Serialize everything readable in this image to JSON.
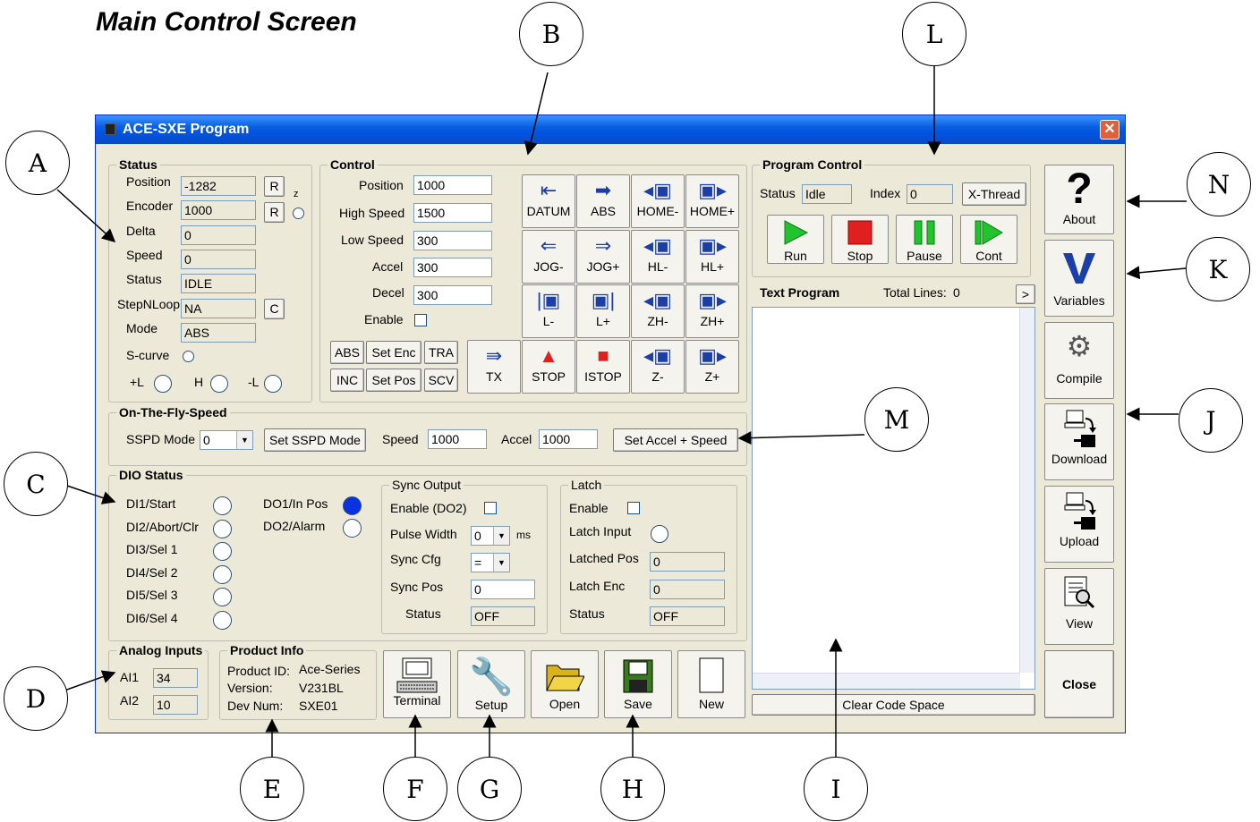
{
  "doc_title": "Main Control Screen",
  "callouts": [
    "A",
    "B",
    "C",
    "D",
    "E",
    "F",
    "G",
    "H",
    "I",
    "J",
    "K",
    "L",
    "M",
    "N"
  ],
  "window": {
    "title": "ACE-SXE Program",
    "close_glyph": "✕"
  },
  "status": {
    "title": "Status",
    "position_label": "Position",
    "position": "-1282",
    "encoder_label": "Encoder",
    "encoder": "1000",
    "delta_label": "Delta",
    "delta": "0",
    "speed_label": "Speed",
    "speed": "0",
    "status_label": "Status",
    "status": "IDLE",
    "stepnloop_label": "StepNLoop",
    "stepnloop": "NA",
    "mode_label": "Mode",
    "mode": "ABS",
    "scurve_label": "S-curve",
    "r1": "R",
    "r2": "R",
    "z": "z",
    "c": "C",
    "pl": "+L",
    "h": "H",
    "ml": "-L"
  },
  "control": {
    "title": "Control",
    "position_label": "Position",
    "position": "1000",
    "high_label": "High Speed",
    "high": "1500",
    "low_label": "Low Speed",
    "low": "300",
    "accel_label": "Accel",
    "accel": "300",
    "decel_label": "Decel",
    "decel": "300",
    "enable_label": "Enable",
    "mode_buttons": [
      "ABS",
      "Set Enc",
      "TRA",
      "INC",
      "Set Pos",
      "SCV"
    ],
    "jog_buttons": [
      {
        "label": "DATUM",
        "icon": "datum-icon",
        "glyph": "⇤"
      },
      {
        "label": "ABS",
        "icon": "abs-arrow-icon",
        "glyph": "➡"
      },
      {
        "label": "HOME-",
        "icon": "home-minus-icon",
        "glyph": "◂▣"
      },
      {
        "label": "HOME+",
        "icon": "home-plus-icon",
        "glyph": "▣▸"
      },
      {
        "label": "JOG-",
        "icon": "jog-minus-icon",
        "glyph": "⇐"
      },
      {
        "label": "JOG+",
        "icon": "jog-plus-icon",
        "glyph": "⇒"
      },
      {
        "label": "HL-",
        "icon": "hl-minus-icon",
        "glyph": "◂▣"
      },
      {
        "label": "HL+",
        "icon": "hl-plus-icon",
        "glyph": "▣▸"
      },
      {
        "label": "L-",
        "icon": "l-minus-icon",
        "glyph": "|▣"
      },
      {
        "label": "L+",
        "icon": "l-plus-icon",
        "glyph": "▣|"
      },
      {
        "label": "ZH-",
        "icon": "zh-minus-icon",
        "glyph": "◂▣"
      },
      {
        "label": "ZH+",
        "icon": "zh-plus-icon",
        "glyph": "▣▸"
      },
      {
        "label": "TX",
        "icon": "tx-icon",
        "glyph": "⇛"
      },
      {
        "label": "STOP",
        "icon": "stop-triangle-icon",
        "glyph": "▲"
      },
      {
        "label": "ISTOP",
        "icon": "istop-icon",
        "glyph": "■"
      },
      {
        "label": "Z-",
        "icon": "z-minus-icon",
        "glyph": "◂▣"
      },
      {
        "label": "Z+",
        "icon": "z-plus-icon",
        "glyph": "▣▸"
      }
    ]
  },
  "program_control": {
    "title": "Program Control",
    "status_label": "Status",
    "status": "Idle",
    "index_label": "Index",
    "index": "0",
    "xthread": "X-Thread",
    "run": "Run",
    "stop": "Stop",
    "pause": "Pause",
    "cont": "Cont"
  },
  "text_program": {
    "title": "Text Program",
    "total_label": "Total Lines:",
    "total": "0",
    "more": ">",
    "clear": "Clear Code Space"
  },
  "side": {
    "about": "About",
    "variables": "Variables",
    "compile": "Compile",
    "download": "Download",
    "upload": "Upload",
    "view": "View",
    "close": "Close"
  },
  "otf": {
    "title": "On-The-Fly-Speed",
    "sspd_label": "SSPD Mode",
    "sspd": "0",
    "set_sspd": "Set SSPD Mode",
    "speed_label": "Speed",
    "speed": "1000",
    "accel_label": "Accel",
    "accel": "1000",
    "set_accel": "Set Accel + Speed"
  },
  "dio": {
    "title": "DIO Status",
    "inputs": [
      "DI1/Start",
      "DI2/Abort/Clr",
      "DI3/Sel 1",
      "DI4/Sel 2",
      "DI5/Sel 3",
      "DI6/Sel 4"
    ],
    "outputs": [
      "DO1/In Pos",
      "DO2/Alarm"
    ]
  },
  "sync": {
    "title": "Sync Output",
    "enable_label": "Enable (DO2)",
    "pw_label": "Pulse Width",
    "pw": "0",
    "ms": "ms",
    "cfg_label": "Sync Cfg",
    "cfg": "=",
    "pos_label": "Sync Pos",
    "pos": "0",
    "status_label": "Status",
    "status": "OFF"
  },
  "latch": {
    "title": "Latch",
    "enable_label": "Enable",
    "input_label": "Latch Input",
    "pos_label": "Latched Pos",
    "pos": "0",
    "enc_label": "Latch Enc",
    "enc": "0",
    "status_label": "Status",
    "status": "OFF"
  },
  "analog": {
    "title": "Analog Inputs",
    "ai1_label": "AI1",
    "ai1": "34",
    "ai2_label": "AI2",
    "ai2": "10"
  },
  "product": {
    "title": "Product Info",
    "id_label": "Product ID:",
    "id": "Ace-Series",
    "ver_label": "Version:",
    "ver": "V231BL",
    "dev_label": "Dev Num:",
    "dev": "SXE01"
  },
  "toolbar": {
    "terminal": "Terminal",
    "setup": "Setup",
    "open": "Open",
    "save": "Save",
    "new": "New"
  },
  "colors": {
    "do1_on": "#0b32e0",
    "run_green": "#22c32e",
    "stop_red": "#e02020",
    "pause_green": "#22c32e"
  }
}
